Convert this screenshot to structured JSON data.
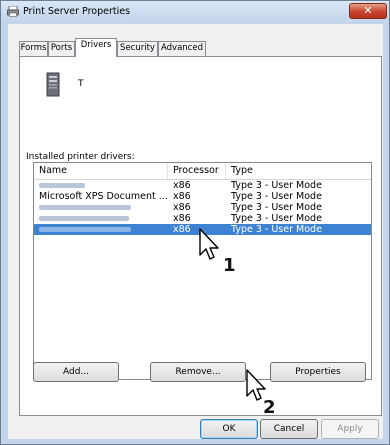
{
  "window": {
    "title": "Print Server Properties",
    "close": "✕"
  },
  "tabs": [
    {
      "label": "Forms"
    },
    {
      "label": "Ports"
    },
    {
      "label": "Drivers"
    },
    {
      "label": "Security"
    },
    {
      "label": "Advanced"
    }
  ],
  "server": {
    "name": "T"
  },
  "drivers_label": "Installed printer drivers:",
  "columns": {
    "name": "Name",
    "processor": "Processor",
    "type": "Type"
  },
  "drivers": [
    {
      "name": "",
      "processor": "x86",
      "type": "Type 3 - User Mode",
      "selected": false
    },
    {
      "name": "Microsoft XPS Document ...",
      "processor": "x86",
      "type": "Type 3 - User Mode",
      "selected": false
    },
    {
      "name": "",
      "processor": "x86",
      "type": "Type 3 - User Mode",
      "selected": false
    },
    {
      "name": "",
      "processor": "x86",
      "type": "Type 3 - User Mode",
      "selected": false
    },
    {
      "name": "",
      "processor": "x86",
      "type": "Type 3 - User Mode",
      "selected": true
    }
  ],
  "buttons": {
    "add": "Add...",
    "remove": "Remove...",
    "properties": "Properties",
    "ok": "OK",
    "cancel": "Cancel",
    "apply": "Apply"
  },
  "annotations": {
    "step1": "1",
    "step2": "2"
  }
}
